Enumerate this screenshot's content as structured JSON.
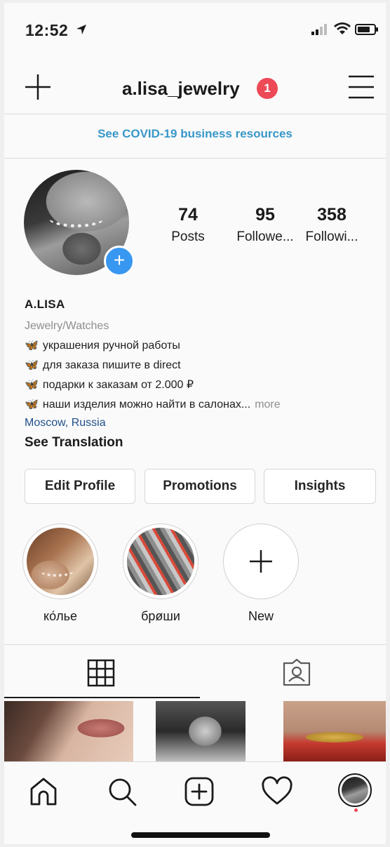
{
  "status_bar": {
    "time": "12:52"
  },
  "header": {
    "username": "a.lisa_jewelry",
    "notification_count": "1"
  },
  "banner": {
    "text": "See COVID-19 business resources"
  },
  "stats": [
    {
      "value": "74",
      "label": "Posts"
    },
    {
      "value": "95",
      "label": "Followe..."
    },
    {
      "value": "358",
      "label": "Followi..."
    }
  ],
  "bio": {
    "name": "A.LISA",
    "category": "Jewelry/Watches",
    "lines": [
      "украшения ручной работы",
      "для заказа пишите в direct",
      "подарки к заказам от 2.000 ₽",
      "наши изделия можно найти в салонах..."
    ],
    "more": "more",
    "location": "Moscow, Russia",
    "translate": "See Translation"
  },
  "buttons": {
    "edit": "Edit Profile",
    "promotions": "Promotions",
    "insights": "Insights"
  },
  "highlights": [
    {
      "label": "ко́лье"
    },
    {
      "label": "брøши"
    },
    {
      "label": "New"
    }
  ],
  "colors": {
    "accent": "#3897f0",
    "link": "#3897c8",
    "badge": "#ed4956"
  }
}
